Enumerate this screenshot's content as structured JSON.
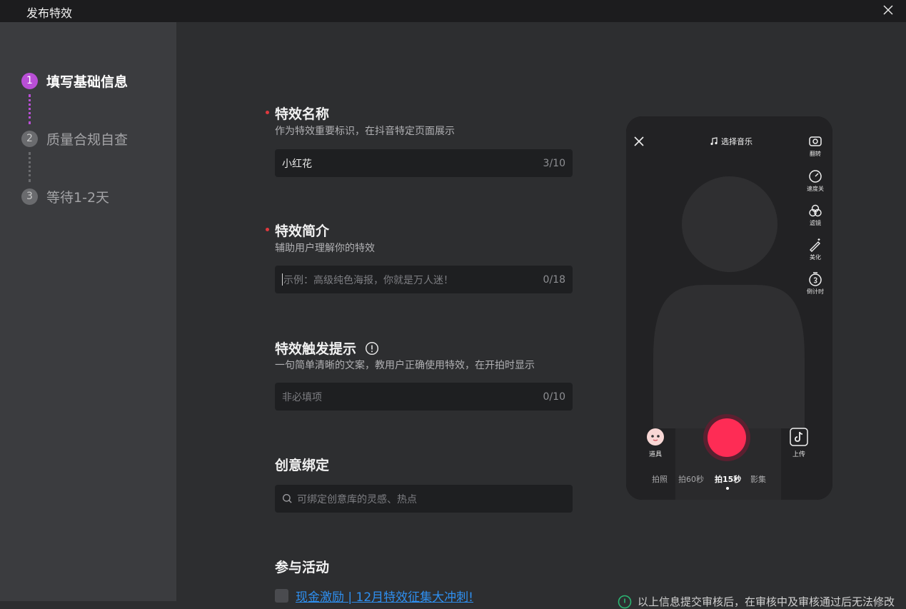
{
  "window": {
    "title": "发布特效"
  },
  "steps": [
    {
      "num": "1",
      "label": "填写基础信息"
    },
    {
      "num": "2",
      "label": "质量合规自查"
    },
    {
      "num": "3",
      "label": "等待1-2天"
    }
  ],
  "form": {
    "name": {
      "title": "特效名称",
      "desc": "作为特效重要标识，在抖音特定页面展示",
      "value": "小红花",
      "count": "3/10"
    },
    "intro": {
      "title": "特效简介",
      "desc": "辅助用户理解你的特效",
      "placeholder": "示例：高级纯色海报，你就是万人迷！",
      "count": "0/18"
    },
    "hint": {
      "title": "特效触发提示",
      "desc": "一句简单清晰的文案，教用户正确使用特效，在开拍时显示",
      "placeholder": "非必填项",
      "count": "0/10"
    },
    "creative": {
      "title": "创意绑定",
      "placeholder": "可绑定创意库的灵感、热点"
    },
    "activity": {
      "title": "参与活动",
      "link": "现金激励 | 12月特效征集大冲刺!"
    }
  },
  "notice": {
    "text": "以上信息提交审核后，在审核中及审核通过后无法修改"
  },
  "phone": {
    "music": "选择音乐",
    "tools": [
      "翻转",
      "速度关",
      "滤镜",
      "美化",
      "倒计时"
    ],
    "props": "道具",
    "upload": "上传",
    "modes": [
      "拍照",
      "拍60秒",
      "拍15秒",
      "影集"
    ],
    "selected_mode": "拍15秒"
  },
  "colors": {
    "accent": "#b94fd6",
    "record": "#fe2c55",
    "link": "#2e8ff0",
    "required": "#e0393e"
  }
}
